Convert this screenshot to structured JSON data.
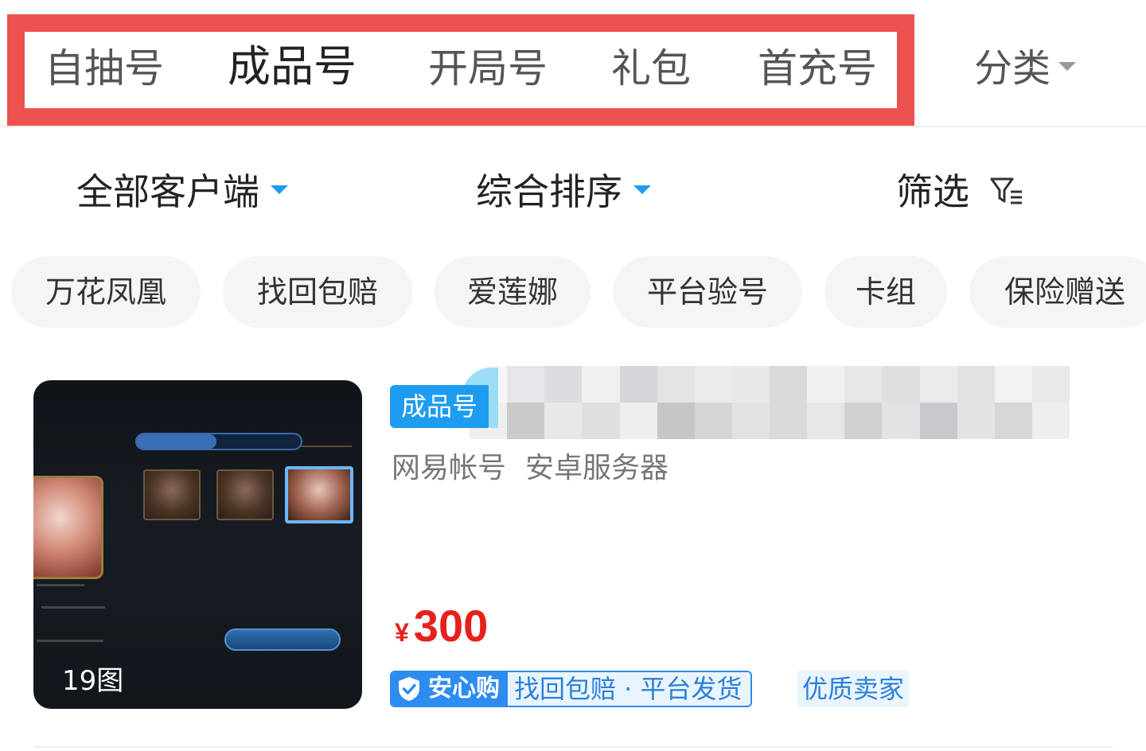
{
  "top_tabs": {
    "items": [
      {
        "label": "自抽号",
        "active": false
      },
      {
        "label": "成品号",
        "active": true
      },
      {
        "label": "开局号",
        "active": false
      },
      {
        "label": "礼包",
        "active": false
      },
      {
        "label": "首充号",
        "active": false
      }
    ],
    "category_label": "分类",
    "highlight_color": "#ee524f"
  },
  "filters": {
    "client": "全部客户端",
    "sort": "综合排序",
    "filter": "筛选",
    "accent": "#1e9cf0"
  },
  "chips": [
    "万花凤凰",
    "找回包赔",
    "爱莲娜",
    "平台验号",
    "卡组",
    "保险赠送"
  ],
  "listing": {
    "photo_count": "19图",
    "type_badge": "成品号",
    "account_type": "网易帐号",
    "server": "安卓服务器",
    "currency": "¥",
    "price": "300",
    "guarantee_brand": "安心购",
    "guarantee_terms": "找回包赔 · 平台发货",
    "seller_tag": "优质卖家",
    "price_color": "#e8201c"
  },
  "icons": {
    "category": "caret-down-icon",
    "filter": "funnel-icon",
    "guarantee": "shield-check-icon"
  }
}
